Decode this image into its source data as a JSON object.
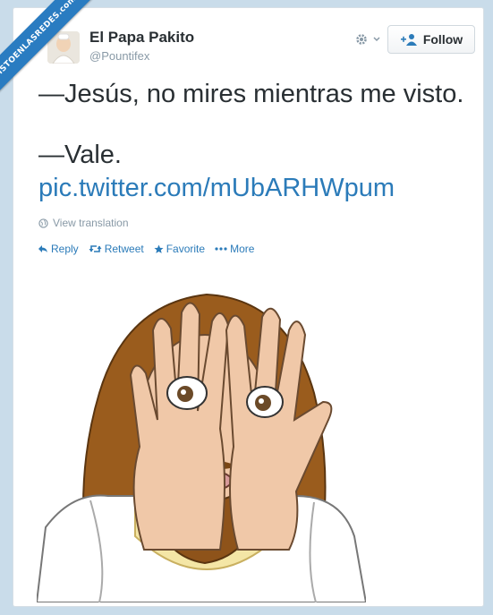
{
  "watermark": "VISTOENLASREDES.com",
  "tweet": {
    "user_name": "El Papa Pakito",
    "user_handle": "@Pountifex",
    "follow_label": "Follow",
    "line1": "—Jesús, no mires mientras me visto.",
    "line2": "—Vale.",
    "link": "pic.twitter.com/mUbARHWpum",
    "translation": "View translation",
    "actions": {
      "reply": "Reply",
      "retweet": "Retweet",
      "favorite": "Favorite",
      "more": "More"
    }
  },
  "icons": [
    "gear-icon",
    "chevron-down-icon",
    "add-user-icon",
    "globe-icon",
    "reply-icon",
    "retweet-icon",
    "star-icon",
    "more-dots-icon"
  ],
  "colors": {
    "link": "#2b7bb9",
    "text": "#292f33",
    "muted": "#8899a6",
    "background": "#c9dcea"
  }
}
